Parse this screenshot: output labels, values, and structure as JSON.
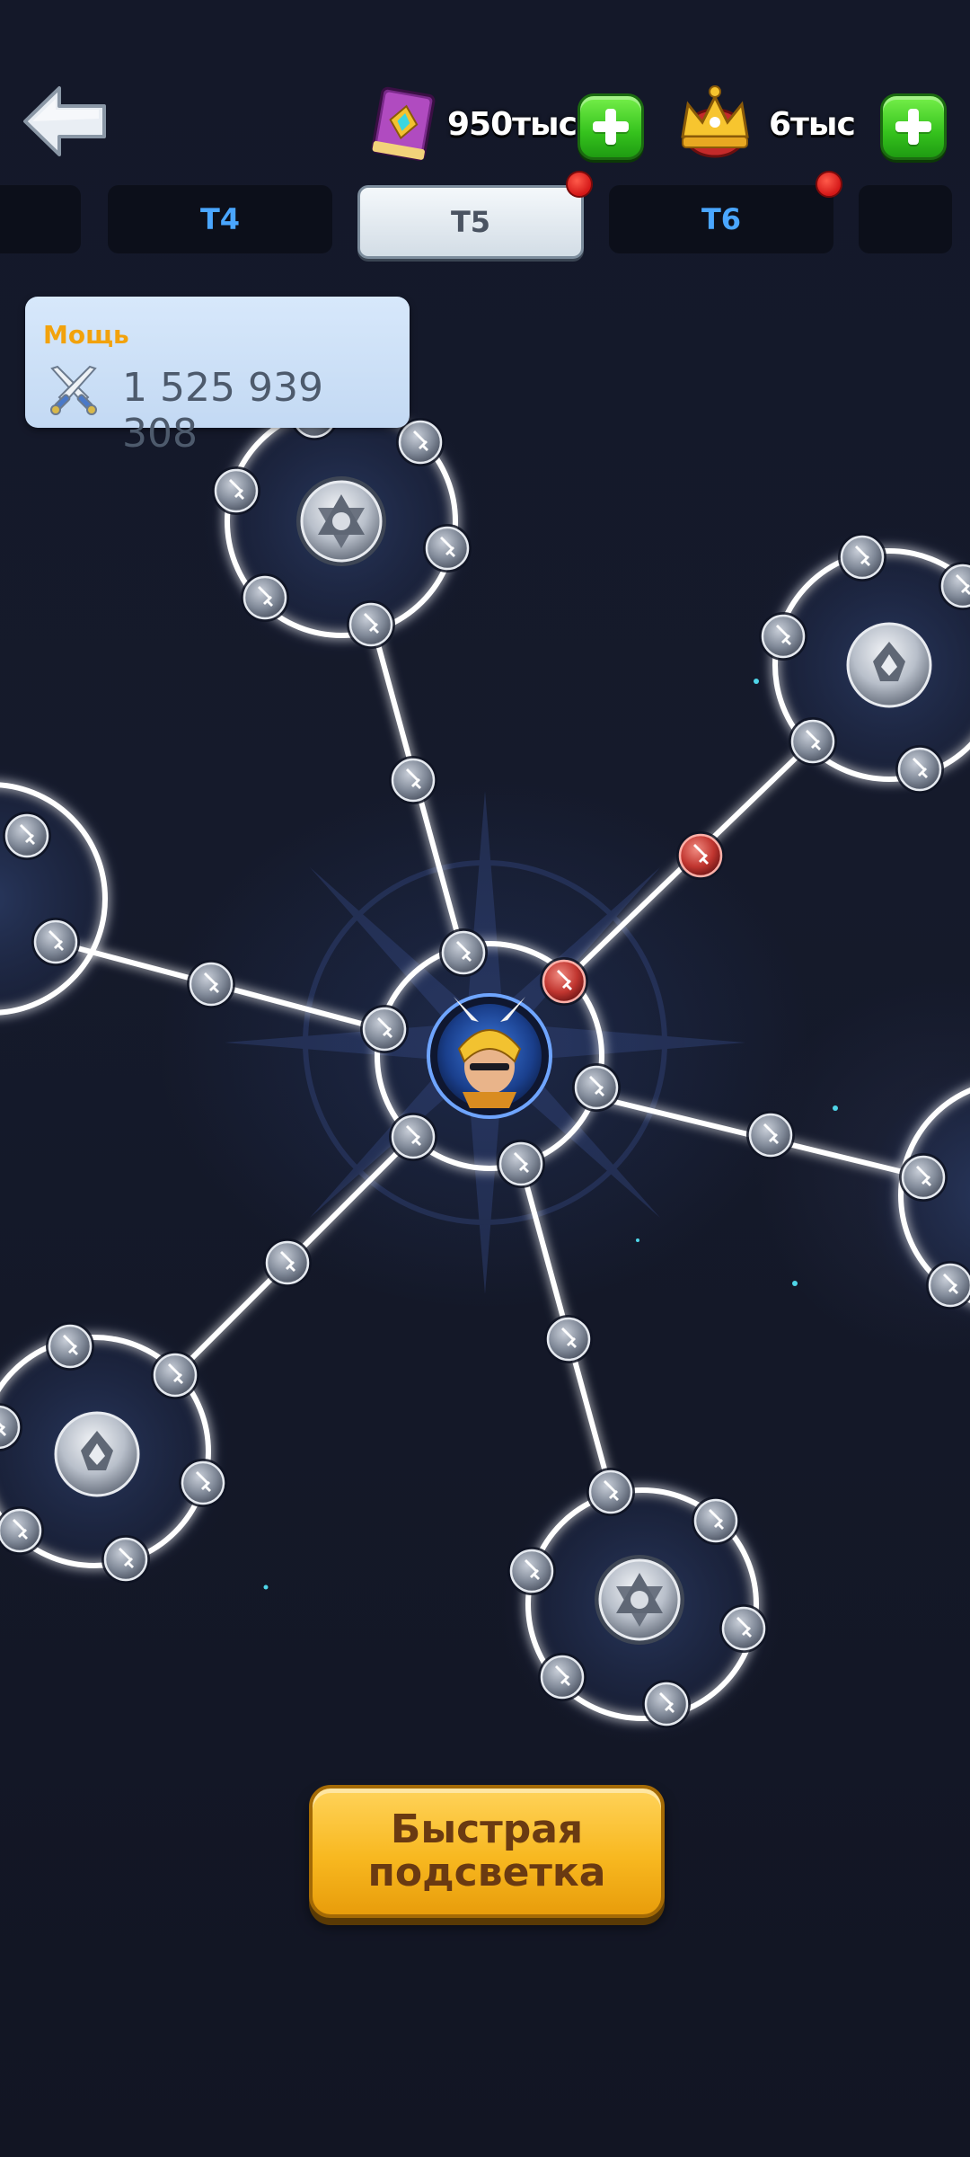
{
  "header": {
    "back_label": "back",
    "resources": [
      {
        "icon": "book-icon",
        "value": "950тыс"
      },
      {
        "icon": "crown-icon",
        "value": "6тыс"
      }
    ]
  },
  "tabs": [
    {
      "label": "",
      "active": false,
      "badge": false
    },
    {
      "label": "T4",
      "active": false,
      "badge": false
    },
    {
      "label": "T5",
      "active": true,
      "badge": true
    },
    {
      "label": "T6",
      "active": false,
      "badge": true
    },
    {
      "label": "",
      "active": false,
      "badge": false
    }
  ],
  "power": {
    "label": "Мощь",
    "value": "1 525 939 308"
  },
  "quick_button": {
    "line1": "Быстрая",
    "line2": "подсветка"
  },
  "colors": {
    "background": "#141829",
    "link_line": "#ffffff",
    "node_normal": "#8c95a3",
    "node_active": "#c33a3a",
    "accent_tab_text": "#4aa6ff",
    "power_label": "#f2a20c",
    "button_gold": "#f8b820"
  }
}
